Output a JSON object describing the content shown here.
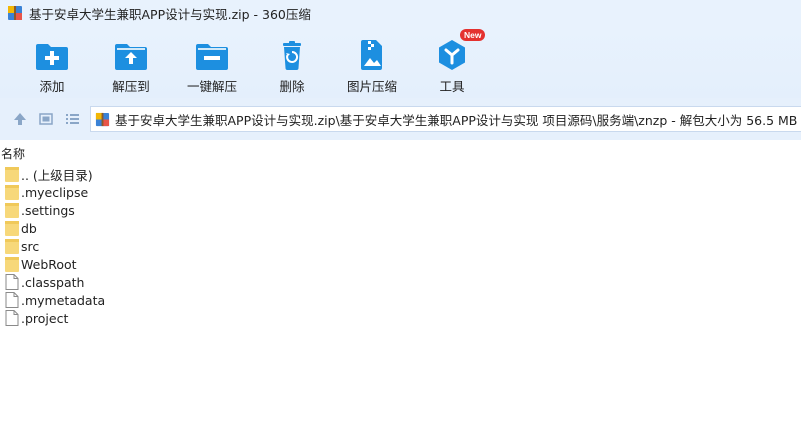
{
  "window": {
    "title": "基于安卓大学生兼职APP设计与实现.zip - 360压缩"
  },
  "toolbar": {
    "items": [
      {
        "label": "添加",
        "icon": "add-icon"
      },
      {
        "label": "解压到",
        "icon": "extract-to-icon"
      },
      {
        "label": "一键解压",
        "icon": "one-click-extract-icon"
      },
      {
        "label": "删除",
        "icon": "delete-icon"
      },
      {
        "label": "图片压缩",
        "icon": "image-compress-icon"
      },
      {
        "label": "工具",
        "icon": "tools-icon",
        "badge": "New"
      }
    ]
  },
  "address": {
    "path": "基于安卓大学生兼职APP设计与实现.zip\\基于安卓大学生兼职APP设计与实现 项目源码\\服务端\\znzp - 解包大小为 56.5 MB"
  },
  "list": {
    "column_name": "名称",
    "entries": [
      {
        "name": ".. (上级目录)",
        "type": "folder"
      },
      {
        "name": ".myeclipse",
        "type": "folder"
      },
      {
        "name": ".settings",
        "type": "folder"
      },
      {
        "name": "db",
        "type": "folder"
      },
      {
        "name": "src",
        "type": "folder"
      },
      {
        "name": "WebRoot",
        "type": "folder"
      },
      {
        "name": ".classpath",
        "type": "file"
      },
      {
        "name": ".mymetadata",
        "type": "file"
      },
      {
        "name": ".project",
        "type": "file"
      }
    ]
  },
  "colors": {
    "toolbar_bg": "#e8f2fd",
    "icon_blue": "#1d8fe0",
    "folder_yellow": "#f7d87a",
    "badge_red": "#e4312f"
  }
}
